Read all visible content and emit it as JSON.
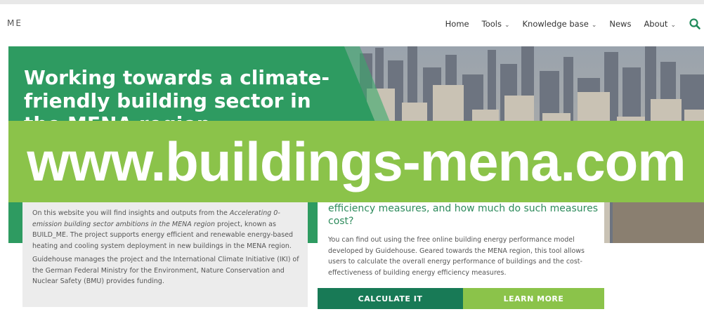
{
  "site": {
    "logo_text": "ME",
    "nav": [
      {
        "label": "Home",
        "has_dropdown": false
      },
      {
        "label": "Tools",
        "has_dropdown": true
      },
      {
        "label": "Knowledge base",
        "has_dropdown": true
      },
      {
        "label": "News",
        "has_dropdown": false
      },
      {
        "label": "About",
        "has_dropdown": true
      }
    ],
    "search_icon": "search-icon"
  },
  "hero": {
    "title": "Working towards a climate-friendly building sector in the MENA region",
    "panel_color": "#2e9b61"
  },
  "banner": {
    "text": "www.buildings-mena.com",
    "color": "#8bc34a"
  },
  "intro": {
    "p1": {
      "a": "On this website you will find insights and outputs from the ",
      "em": "Accelerating 0-emission building sector ambitions in the MENA region",
      "b": " project, known as BUILD_ME. The project supports energy efficient and renewable energy-based heating and cooling system deployment in new buildings in the MENA region."
    },
    "p2": "Guidehouse manages the project and the International Climate Initiative (IKI) of the German Federal Ministry for the Environment, Nature Conservation and Nuclear Safety (BMU) provides funding."
  },
  "tool_card": {
    "question_visible": "efficiency measures, and how much do such measures cost?",
    "description": "You can find out using the free online building energy performance model developed by Guidehouse. Geared towards the MENA region, this tool allows users to calculate the overall energy performance of buildings and the cost-effectiveness of building energy efficiency measures.",
    "calculate_label": "CALCULATE IT",
    "learn_label": "LEARN MORE",
    "calculate_color": "#187a56",
    "learn_color": "#8bc34a"
  }
}
